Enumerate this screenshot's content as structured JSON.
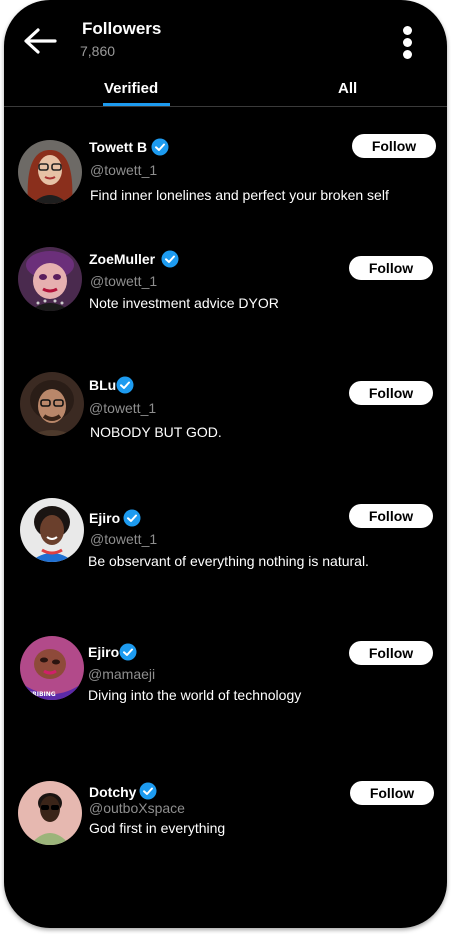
{
  "header": {
    "title": "Followers",
    "count": "7,860"
  },
  "tabs": [
    {
      "label": "Verified",
      "active": true
    },
    {
      "label": "All",
      "active": false
    }
  ],
  "accent_color": "#1d9bf0",
  "followers": [
    {
      "name": "Towett B",
      "handle": "@towett_1",
      "bio": "Find inner lonelines and perfect your broken self",
      "button": "Follow",
      "verified": true
    },
    {
      "name": "ZoeMuller",
      "handle": "@towett_1",
      "bio": "Note investment advice DYOR",
      "button": "Follow",
      "verified": true
    },
    {
      "name": "BLu",
      "handle": "@towett_1",
      "bio": "NOBODY BUT GOD.",
      "button": "Follow",
      "verified": true
    },
    {
      "name": "Ejiro",
      "handle": "@towett_1",
      "bio": "Be observant of everything nothing is natural.",
      "button": "Follow",
      "verified": true
    },
    {
      "name": "Ejiro",
      "handle": "@mamaeji",
      "bio": "Diving into the world of technology",
      "button": "Follow",
      "verified": true
    },
    {
      "name": "Dotchy",
      "handle": "@outboXspace",
      "bio": "God first in everything",
      "button": "Follow",
      "verified": true
    }
  ]
}
